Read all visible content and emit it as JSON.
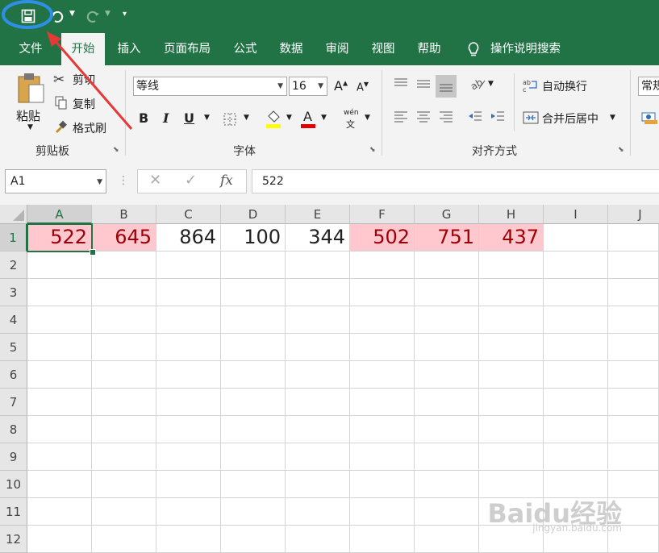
{
  "qat": {
    "save_icon": "save-icon",
    "undo_icon": "undo-icon",
    "redo_icon": "redo-icon"
  },
  "tabs": [
    {
      "label": "文件"
    },
    {
      "label": "开始"
    },
    {
      "label": "插入"
    },
    {
      "label": "页面布局"
    },
    {
      "label": "公式"
    },
    {
      "label": "数据"
    },
    {
      "label": "审阅"
    },
    {
      "label": "视图"
    },
    {
      "label": "帮助"
    }
  ],
  "tell_me": "操作说明搜索",
  "clipboard": {
    "paste": "粘贴",
    "cut": "剪切",
    "copy": "复制",
    "format_painter": "格式刷",
    "group": "剪贴板"
  },
  "font": {
    "name": "等线",
    "size": "16",
    "group": "字体",
    "bold": "B",
    "italic": "I",
    "underline": "U",
    "phonetic_top": "wén",
    "phonetic_bottom": "文"
  },
  "alignment": {
    "wrap": "自动换行",
    "merge": "合并后居中",
    "group": "对齐方式"
  },
  "number": {
    "format": "常规"
  },
  "formula_bar": {
    "name_box": "A1",
    "fx": "fx",
    "value": "522"
  },
  "columns": [
    "A",
    "B",
    "C",
    "D",
    "E",
    "F",
    "G",
    "H",
    "I",
    "J"
  ],
  "rows": [
    "1",
    "2",
    "3",
    "4",
    "5",
    "6",
    "7",
    "8",
    "9",
    "10",
    "11",
    "12"
  ],
  "row1": [
    "522",
    "645",
    "864",
    "100",
    "344",
    "502",
    "751",
    "437"
  ],
  "colors": {
    "accent": "#217346",
    "highlight_fill": "#ffc7ce",
    "highlight_text": "#9c0006",
    "annotation": "#2f8fe6",
    "arrow": "#e53935"
  },
  "watermark": {
    "main": "Baidu经验",
    "sub": "jingyan.baidu.com"
  }
}
